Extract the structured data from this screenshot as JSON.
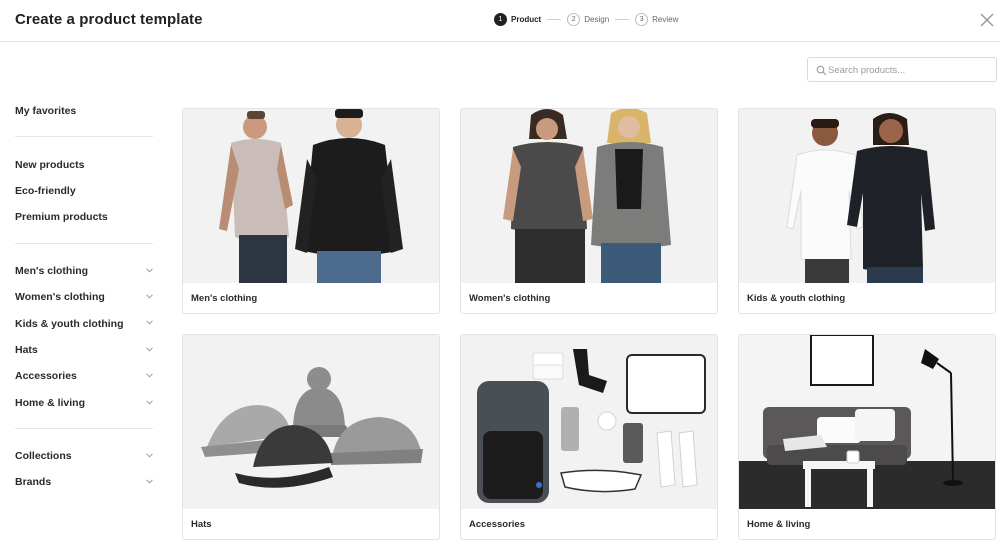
{
  "header": {
    "title": "Create a product template",
    "steps": [
      {
        "num": "1",
        "label": "Product"
      },
      {
        "num": "2",
        "label": "Design"
      },
      {
        "num": "3",
        "label": "Review"
      }
    ],
    "close_icon": "close-icon"
  },
  "search": {
    "placeholder": "Search products...",
    "value": ""
  },
  "sidebar": {
    "favorites": "My favorites",
    "groups": [
      [
        "New products",
        "Eco-friendly",
        "Premium products"
      ],
      [
        "Men's clothing",
        "Women's clothing",
        "Kids & youth clothing",
        "Hats",
        "Accessories",
        "Home & living"
      ],
      [
        "Collections",
        "Brands"
      ]
    ]
  },
  "categories": [
    {
      "label": "Men's clothing"
    },
    {
      "label": "Women's clothing"
    },
    {
      "label": "Kids & youth clothing"
    },
    {
      "label": "Hats"
    },
    {
      "label": "Accessories"
    },
    {
      "label": "Home & living"
    }
  ],
  "colors": {
    "accent": "#222222",
    "border": "#e3e3e3",
    "photo_bg": "#f2f2f2"
  }
}
